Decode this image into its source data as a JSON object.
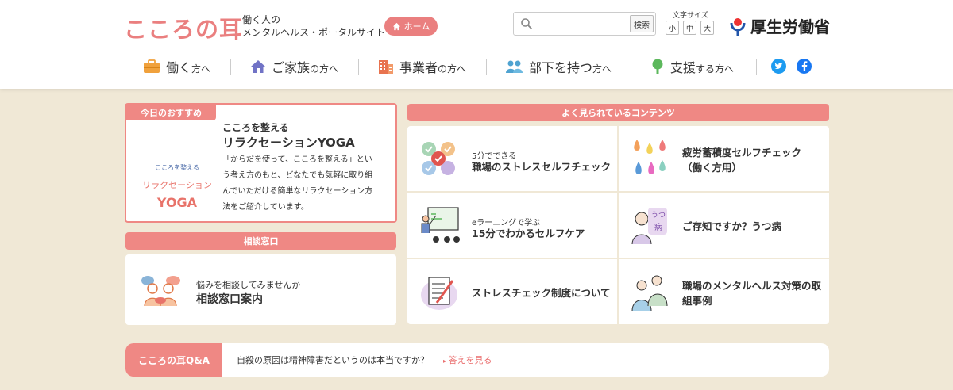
{
  "header": {
    "logo": "こころの耳",
    "tagline_line1": "働く人の",
    "tagline_line2": "メンタルヘルス・ポータルサイト",
    "home_label": "ホーム",
    "search_placeholder": "",
    "search_button": "検索",
    "font_size_label": "文字サイズ",
    "font_sizes": [
      "小",
      "中",
      "大"
    ],
    "ministry": "厚生労働省"
  },
  "nav": [
    {
      "main": "働く",
      "suffix": "方へ",
      "icon": "briefcase-icon"
    },
    {
      "main": "ご家族",
      "suffix": "の方へ",
      "icon": "house-icon"
    },
    {
      "main": "事業者",
      "suffix": "の方へ",
      "icon": "building-icon"
    },
    {
      "main": "部下を持つ",
      "suffix": "方へ",
      "icon": "people-icon"
    },
    {
      "main": "支援",
      "suffix": "する方へ",
      "icon": "tree-icon"
    }
  ],
  "colors": {
    "accent": "#ef8884",
    "background": "#f0e8d6",
    "twitter": "#1d9bf0",
    "facebook": "#1877f2"
  },
  "recommend": {
    "tab": "今日のおすすめ",
    "image_line1": "こころを整える",
    "image_line2": "リラクセーション",
    "image_line3": "YOGA",
    "subtitle": "こころを整える",
    "title": "リラクセーションYOGA",
    "desc_lines": [
      "「からだを使って、こころを整える」とい",
      "う考え方のもと、どなたでも気軽に取り組",
      "んでいただける簡単なリラクセーション方",
      "法をご紹介しています。"
    ]
  },
  "consult": {
    "header": "相談窓口",
    "small": "悩みを相談してみませんか",
    "title": "相談窓口案内"
  },
  "popular": {
    "header": "よく見られているコンテンツ",
    "items": [
      {
        "small": "5分でできる",
        "lines": [
          "職場のストレスセルフチェック"
        ],
        "icon": "checklist-icon"
      },
      {
        "small": "",
        "lines": [
          "疲労蓄積度セルフチェック",
          "（働く方用）"
        ],
        "icon": "droplets-icon"
      },
      {
        "small": "eラーニングで学ぶ",
        "lines": [
          "15分でわかるセルフケア"
        ],
        "icon": "teacher-icon"
      },
      {
        "small": "",
        "lines": [
          "ご存知ですか？うつ病"
        ],
        "icon": "depression-icon"
      },
      {
        "small": "",
        "lines": [
          "ストレスチェック制度について"
        ],
        "icon": "document-icon"
      },
      {
        "small": "",
        "lines": [
          "職場のメンタルヘルス対策の取",
          "組事例"
        ],
        "icon": "workers-icon"
      }
    ]
  },
  "qa": {
    "label": "こころの耳Q&A",
    "question": "自殺の原因は精神障害だというのは本当ですか？",
    "link": "答えを見る"
  }
}
